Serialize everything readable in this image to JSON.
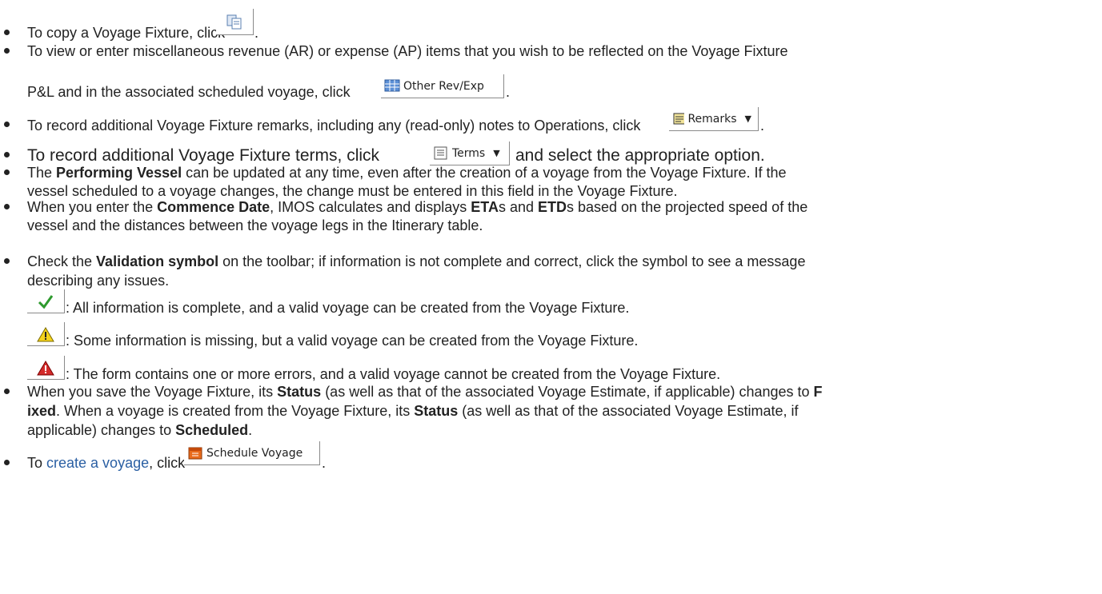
{
  "items": {
    "copy": {
      "pre": "To copy a Voyage Fixture, click",
      "post": "."
    },
    "other": {
      "line1": "To view or enter miscellaneous revenue (AR) or expense (AP) items that you wish to be reflected on the Voyage Fixture",
      "pre": "P&L and in the associated scheduled voyage, click",
      "post": ".",
      "button": "Other Rev/Exp"
    },
    "remarks": {
      "pre": "To record additional Voyage Fixture remarks, including any (read-only) notes to Operations, click",
      "post": ".",
      "button": "Remarks"
    },
    "terms": {
      "pre": "To record additional Voyage Fixture terms, click",
      "post": "and select the appropriate option.",
      "button": "Terms"
    },
    "vessel": {
      "l1a": "The ",
      "l1b": "Performing Vessel",
      "l1c": " can be updated at any time, even after the creation of a voyage from the Voyage Fixture. If the",
      "l2": "vessel scheduled to a voyage changes, the change must be entered in this field in the Voyage Fixture."
    },
    "commence": {
      "l1a": "When you enter the ",
      "l1b": "Commence Date",
      "l1c": ", IMOS calculates and displays ",
      "l1d": "ETA",
      "l1e": "s and ",
      "l1f": "ETD",
      "l1g": "s based on the projected speed of the",
      "l2": "vessel and the distances between the voyage legs in the Itinerary table."
    },
    "validation": {
      "l1a": "Check the ",
      "l1b": "Validation symbol",
      "l1c": " on the toolbar; if information is not complete and correct, click the symbol to see a message",
      "l2": "describing any issues.",
      "ok": ": All information is complete, and a valid voyage can be created from the Voyage Fixture.",
      "warn": ": Some information is missing, but a valid voyage can be created from the Voyage Fixture.",
      "error": ": The form contains one or more errors, and a valid voyage cannot be created from the Voyage Fixture."
    },
    "status": {
      "l1a": "When you save the Voyage Fixture, its ",
      "l1b": "Status",
      "l1c": " (as well as that of the associated Voyage Estimate, if applicable) changes to ",
      "l1d": "F",
      "l2a": "ixed",
      "l2b": ". When a voyage is created from the Voyage Fixture, its ",
      "l2c": "Status",
      "l2d": " (as well as that of the associated Voyage Estimate, if",
      "l3a": "applicable) changes to ",
      "l3b": "Scheduled",
      "l3c": "."
    },
    "create": {
      "pre": "To ",
      "link": "create a voyage",
      "mid": ", click",
      "post": ".",
      "button": "Schedule Voyage"
    }
  }
}
